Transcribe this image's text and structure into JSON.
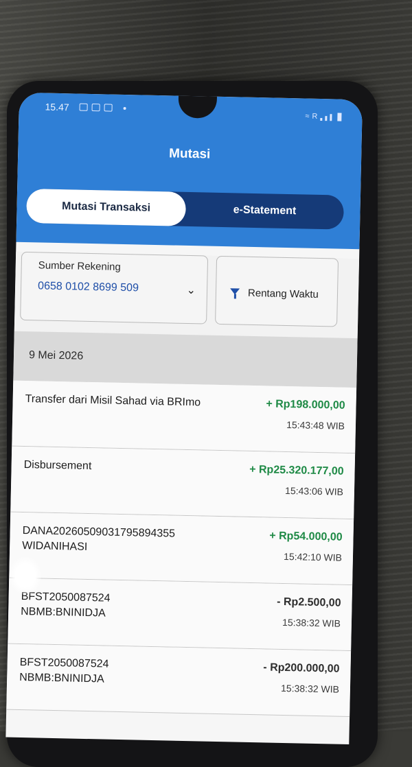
{
  "status_bar": {
    "time": "15.47",
    "network": "R"
  },
  "header": {
    "title": "Mutasi"
  },
  "tabs": [
    {
      "label": "Mutasi Transaksi",
      "active": true
    },
    {
      "label": "e-Statement",
      "active": false
    }
  ],
  "filters": {
    "account_label": "Sumber Rekening",
    "account_value": "0658 0102 8699 509",
    "date_range_label": "Rentang Waktu"
  },
  "date_group": "9 Mei 2026",
  "transactions": [
    {
      "description": "Transfer dari Misil Sahad via BRImo",
      "amount": "+ Rp198.000,00",
      "time": "15:43:48 WIB",
      "type": "credit"
    },
    {
      "description": "Disbursement",
      "amount": "+ Rp25.320.177,00",
      "time": "15:43:06 WIB",
      "type": "credit"
    },
    {
      "description": "DANA20260509031795894355\nWIDANIHASI",
      "amount": "+ Rp54.000,00",
      "time": "15:42:10 WIB",
      "type": "credit"
    },
    {
      "description": "BFST2050087524\nNBMB:BNINIDJA",
      "amount": "- Rp2.500,00",
      "time": "15:38:32 WIB",
      "type": "debit"
    },
    {
      "description": "BFST2050087524\nNBMB:BNINIDJA",
      "amount": "- Rp200.000,00",
      "time": "15:38:32 WIB",
      "type": "debit"
    }
  ],
  "colors": {
    "header_blue": "#2f7fd6",
    "tab_navy": "#153a78",
    "credit_green": "#1f8a46"
  }
}
